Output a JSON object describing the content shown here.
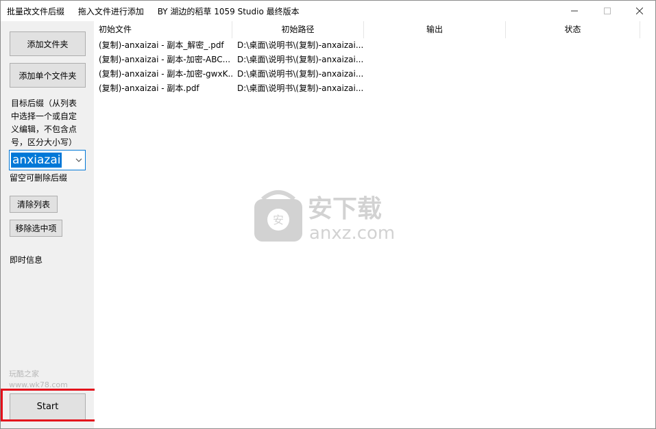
{
  "window": {
    "title_items": [
      "批量改文件后缀",
      "拖入文件进行添加",
      "BY 湖边的稻草 1059 Studio 最终版本"
    ]
  },
  "sidebar": {
    "add_folder": "添加文件夹",
    "add_single_folder": "添加单个文件夹",
    "target_suffix_label": [
      "目标后缀（从列表",
      "中选择一个或自定",
      "义编辑，不包含点",
      "号，区分大小写）"
    ],
    "suffix_value": "anxiazai",
    "empty_hint": "留空可删除后缀",
    "clear_list": "清除列表",
    "remove_selected": "移除选中项",
    "instant_info": "即时信息",
    "watermark_lines": [
      "玩酷之家",
      "www.wk78.com"
    ],
    "start": "Start"
  },
  "table": {
    "columns": [
      "初始文件",
      "初始路径",
      "输出",
      "状态"
    ],
    "rows": [
      {
        "file": "(复制)-anxaizai - 副本_解密_.pdf",
        "path": "D:\\桌面\\说明书\\(复制)-anxaizai..."
      },
      {
        "file": "(复制)-anxaizai - 副本-加密-ABC...",
        "path": "D:\\桌面\\说明书\\(复制)-anxaizai..."
      },
      {
        "file": "(复制)-anxaizai - 副本-加密-gwxK...",
        "path": "D:\\桌面\\说明书\\(复制)-anxaizai..."
      },
      {
        "file": "(复制)-anxaizai - 副本.pdf",
        "path": "D:\\桌面\\说明书\\(复制)-anxaizai..."
      }
    ]
  },
  "watermark": {
    "cn": "安下载",
    "en": "anxz.com",
    "badge": "安"
  },
  "colors": {
    "highlight": "#e3101b",
    "selection": "#0078d7"
  }
}
